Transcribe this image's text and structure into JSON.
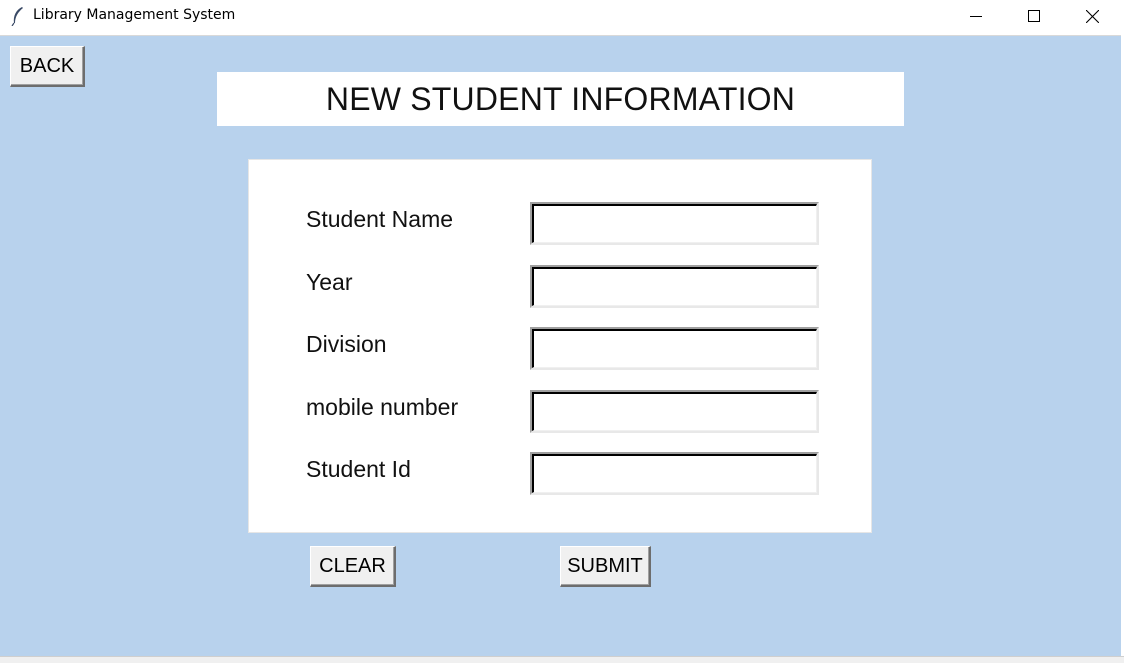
{
  "window": {
    "title": "Library Management System",
    "controls": [
      "minimize-icon",
      "maximize-icon",
      "close-icon"
    ]
  },
  "back_button": "BACK",
  "heading": "NEW STUDENT INFORMATION",
  "form": {
    "fields": [
      {
        "label": "Student Name",
        "value": ""
      },
      {
        "label": "Year",
        "value": ""
      },
      {
        "label": "Division",
        "value": ""
      },
      {
        "label": "mobile number",
        "value": ""
      },
      {
        "label": "Student Id",
        "value": ""
      }
    ]
  },
  "buttons": {
    "clear": "CLEAR",
    "submit": "SUBMIT"
  },
  "colors": {
    "background": "#b8d2ed",
    "panel": "#ffffff",
    "button": "#f0f0f0"
  }
}
